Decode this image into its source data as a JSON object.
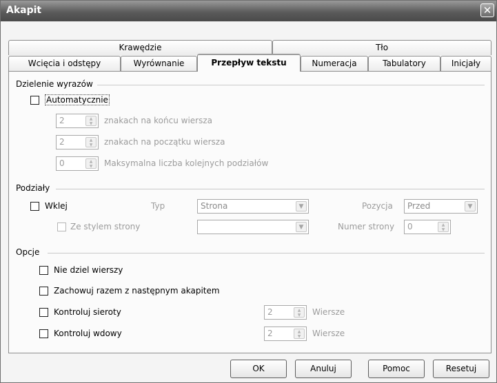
{
  "window": {
    "title": "Akapit",
    "close_icon": "close-icon"
  },
  "tabs": {
    "row_back": [
      "Krawędzie",
      "Tło"
    ],
    "row_front": [
      "Wcięcia i odstępy",
      "Wyrównanie",
      "Przepływ tekstu",
      "Numeracja",
      "Tabulatory",
      "Inicjały"
    ],
    "active": "Przepływ tekstu"
  },
  "hyphenation": {
    "heading": "Dzielenie wyrazów",
    "auto_label": "Automatycznie",
    "auto_checked": false,
    "end_value": "2",
    "end_label": "znakach na końcu wiersza",
    "start_value": "2",
    "start_label": "znakach na początku wiersza",
    "max_value": "0",
    "max_label": "Maksymalna liczba kolejnych podziałów"
  },
  "breaks": {
    "heading": "Podziały",
    "insert_label": "Wklej",
    "type_label": "Typ",
    "type_value": "Strona",
    "position_label": "Pozycja",
    "position_value": "Przed",
    "page_style_label": "Ze stylem strony",
    "page_number_label": "Numer strony",
    "page_number_value": "0"
  },
  "options": {
    "heading": "Opcje",
    "no_split_label": "Nie dziel wierszy",
    "keep_next_label": "Zachowuj razem z następnym akapitem",
    "orphans_label": "Kontroluj sieroty",
    "orphans_value": "2",
    "orphans_unit": "Wiersze",
    "widows_label": "Kontroluj wdowy",
    "widows_value": "2",
    "widows_unit": "Wiersze"
  },
  "buttons": {
    "ok": "OK",
    "cancel": "Anuluj",
    "help": "Pomoc",
    "reset": "Resetuj"
  }
}
